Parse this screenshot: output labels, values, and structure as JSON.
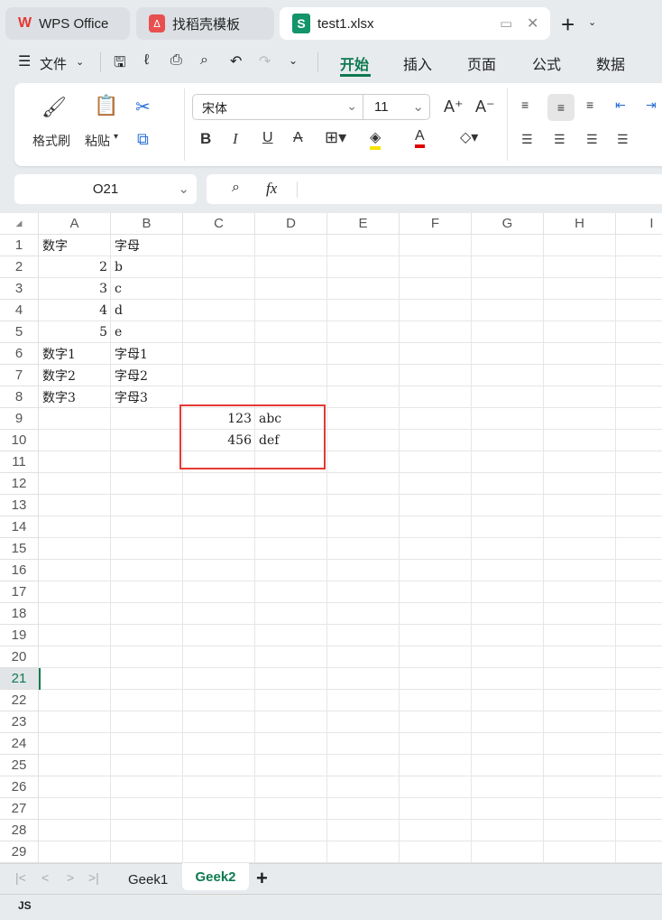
{
  "tabs": [
    {
      "label": "WPS Office"
    },
    {
      "label": "找稻壳模板"
    },
    {
      "label": "test1.xlsx"
    }
  ],
  "menu": {
    "file": "文件",
    "items": [
      "开始",
      "插入",
      "页面",
      "公式",
      "数据"
    ]
  },
  "ribbon": {
    "format_painter": "格式刷",
    "paste": "粘贴",
    "font": "宋体",
    "font_size": "11",
    "bold": "B",
    "italic": "I",
    "underline": "U"
  },
  "name_box": "O21",
  "formula_label": "fx",
  "formula_value": "",
  "columns": [
    "A",
    "B",
    "C",
    "D",
    "E",
    "F",
    "G",
    "H",
    "I"
  ],
  "row_count": 29,
  "active_row": 21,
  "cells": [
    {
      "r": 1,
      "c": 0,
      "v": "数字"
    },
    {
      "r": 1,
      "c": 1,
      "v": "字母"
    },
    {
      "r": 2,
      "c": 0,
      "v": "2",
      "num": true
    },
    {
      "r": 2,
      "c": 1,
      "v": "b"
    },
    {
      "r": 3,
      "c": 0,
      "v": "3",
      "num": true
    },
    {
      "r": 3,
      "c": 1,
      "v": "c"
    },
    {
      "r": 4,
      "c": 0,
      "v": "4",
      "num": true
    },
    {
      "r": 4,
      "c": 1,
      "v": "d"
    },
    {
      "r": 5,
      "c": 0,
      "v": "5",
      "num": true
    },
    {
      "r": 5,
      "c": 1,
      "v": "e"
    },
    {
      "r": 6,
      "c": 0,
      "v": "数字1"
    },
    {
      "r": 6,
      "c": 1,
      "v": "字母1"
    },
    {
      "r": 7,
      "c": 0,
      "v": "数字2"
    },
    {
      "r": 7,
      "c": 1,
      "v": "字母2"
    },
    {
      "r": 8,
      "c": 0,
      "v": "数字3"
    },
    {
      "r": 8,
      "c": 1,
      "v": "字母3"
    },
    {
      "r": 9,
      "c": 2,
      "v": "123",
      "num": true
    },
    {
      "r": 9,
      "c": 3,
      "v": "abc"
    },
    {
      "r": 10,
      "c": 2,
      "v": "456",
      "num": true
    },
    {
      "r": 10,
      "c": 3,
      "v": "def"
    }
  ],
  "sheets": [
    {
      "label": "Geek1"
    },
    {
      "label": "Geek2",
      "active": true
    }
  ],
  "colors": {
    "accent": "#0e7a4f",
    "highlight_box": "#e53935"
  }
}
